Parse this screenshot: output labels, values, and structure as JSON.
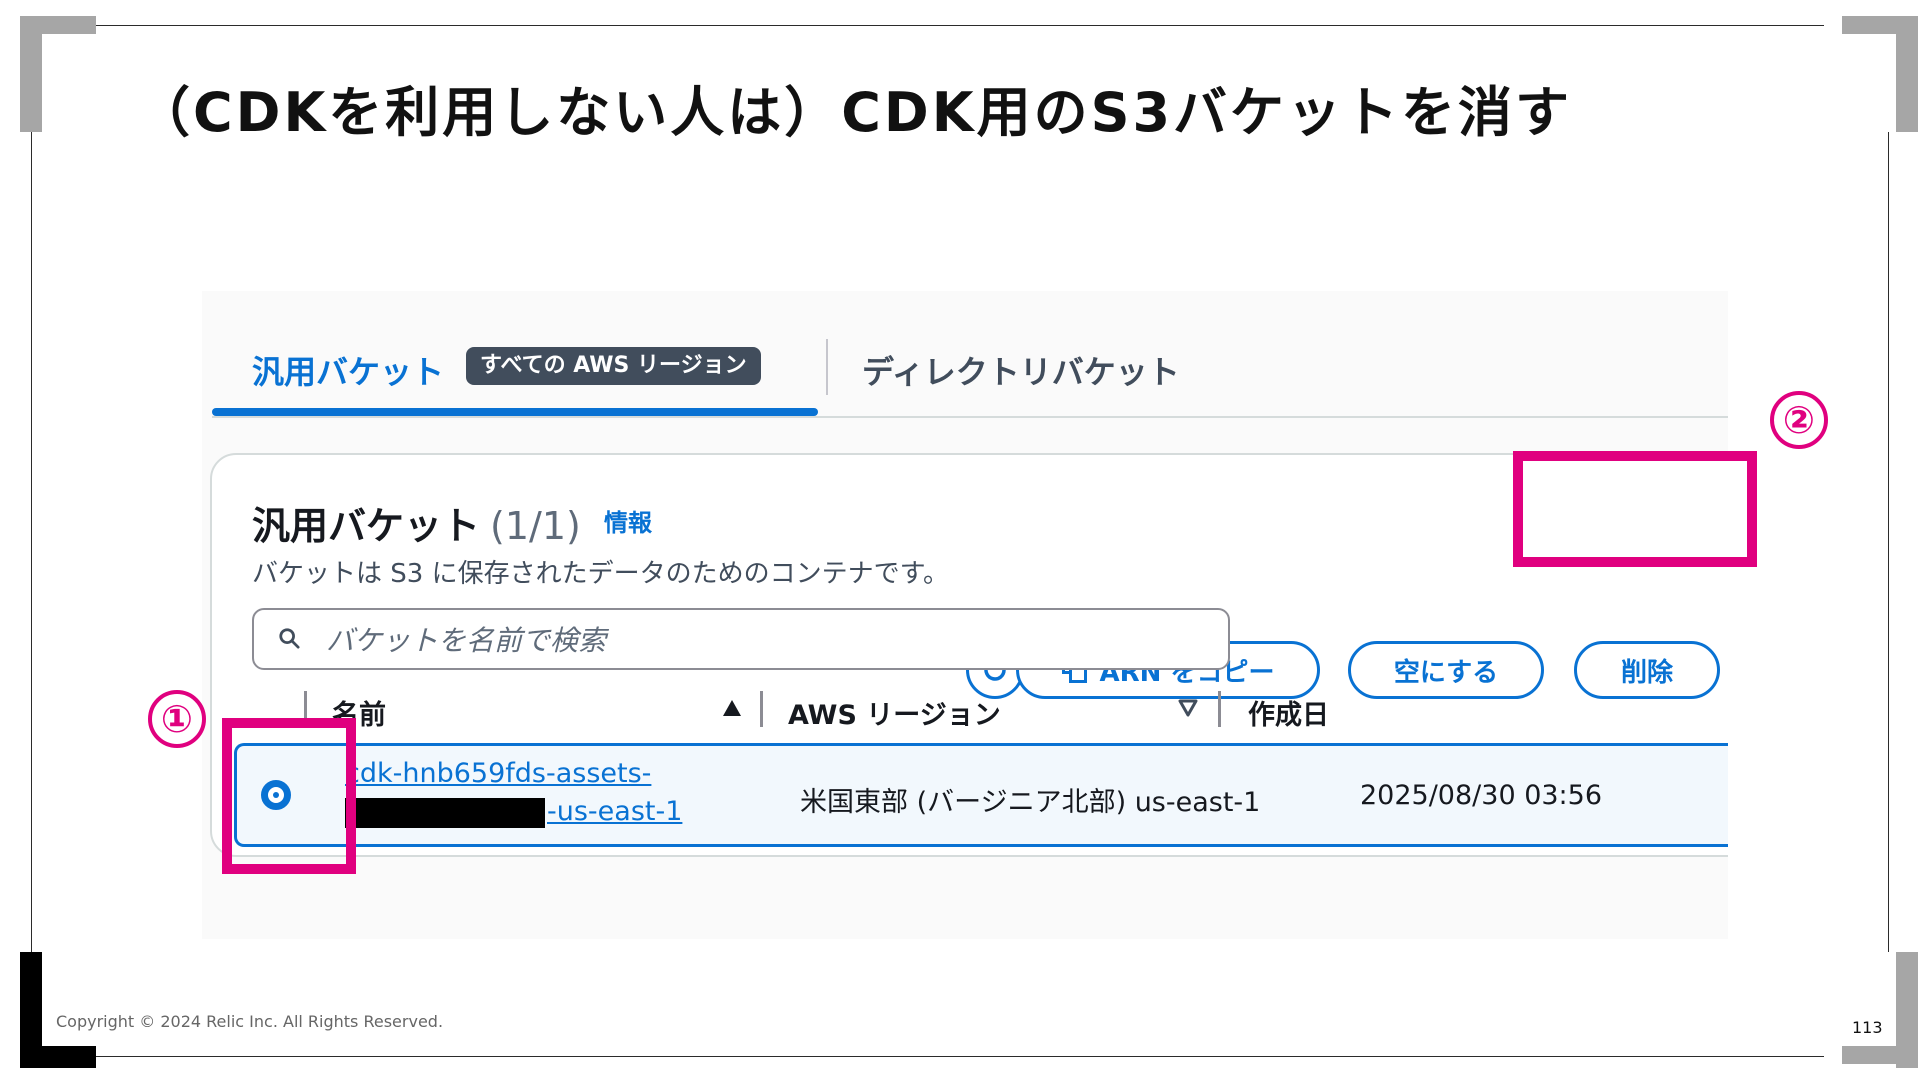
{
  "slide": {
    "title": "（CDKを利用しない人は）CDK用のS3バケットを消す",
    "copyright": "Copyright © 2024 Relic Inc. All Rights Reserved.",
    "page_number": "113"
  },
  "tabs": {
    "general_label": "汎用バケット",
    "region_badge": "すべての AWS リージョン",
    "directory_label": "ディレクトリバケット"
  },
  "panel": {
    "title": "汎用バケット",
    "count": "(1/1)",
    "info_link": "情報",
    "description": "バケットは S3 に保存されたデータのためのコンテナです。",
    "buttons": {
      "copy_arn": "ARN をコピー",
      "empty": "空にする",
      "delete": "削除"
    },
    "search": {
      "placeholder": "バケットを名前で検索"
    },
    "columns": [
      "名前",
      "AWS リージョン",
      "作成日"
    ],
    "rows": [
      {
        "name_line1": "cdk-hnb659fds-assets-",
        "name_line2_tail": "-us-east-1",
        "region": "米国東部 (バージニア北部) us-east-1",
        "created": "2025/08/30 03:56",
        "selected": true
      }
    ]
  },
  "annotations": {
    "marker_1": "①",
    "marker_2": "②",
    "highlight_color": "#e0007f"
  },
  "colors": {
    "accent": "#0972d3",
    "badge_bg": "#414d5c"
  }
}
